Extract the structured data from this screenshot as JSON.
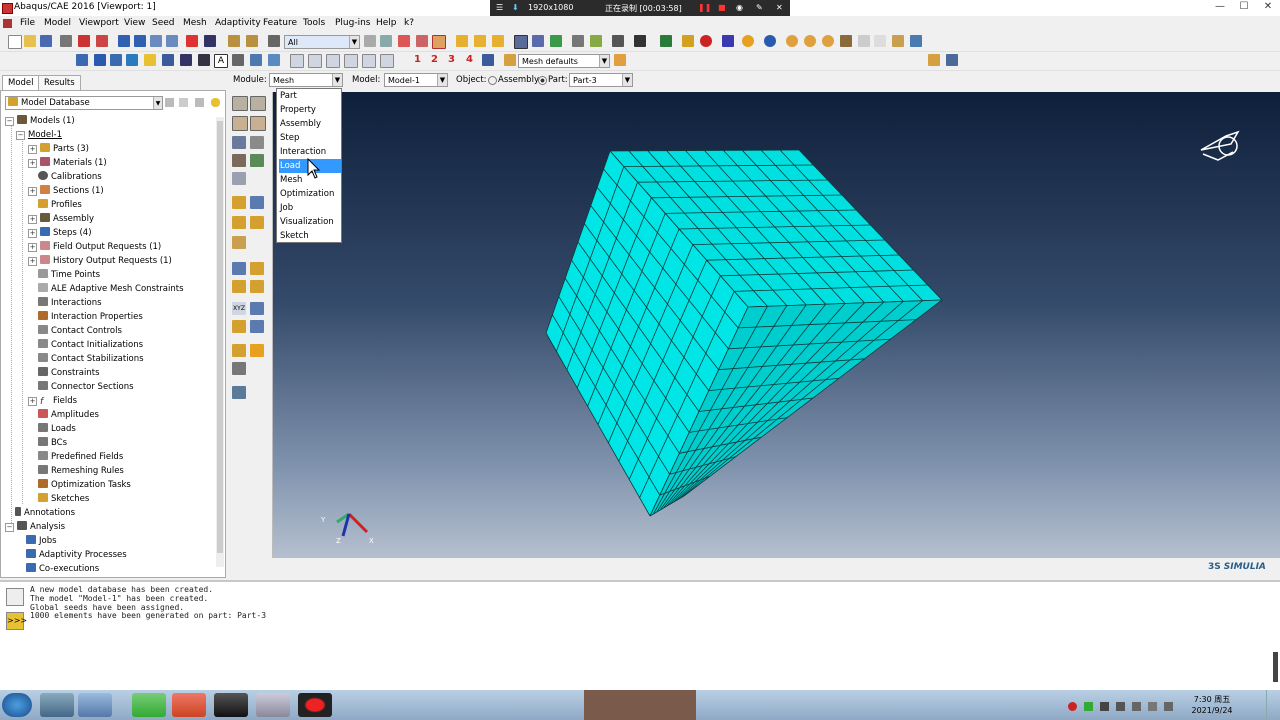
{
  "window": {
    "title": "Abaqus/CAE 2016 [Viewport: 1]",
    "controls": [
      "—",
      "☐",
      "✕"
    ]
  },
  "recorder": {
    "resolution": "1920x1080",
    "status": "正在录制 [00:03:58]"
  },
  "menubar": {
    "items": [
      "File",
      "Model",
      "Viewport",
      "View",
      "Seed",
      "Mesh",
      "Adaptivity",
      "Feature",
      "Tools",
      "Plug-ins",
      "Help",
      "k?"
    ]
  },
  "toolbar": {
    "selection_filter": "All",
    "mesh_defaults": "Mesh defaults",
    "number_buttons": [
      "1",
      "2",
      "3",
      "4"
    ]
  },
  "context": {
    "module_label": "Module:",
    "module_value": "Mesh",
    "model_label": "Model:",
    "model_value": "Model-1",
    "object_label": "Object:",
    "assembly_label": "Assembly",
    "part_label": "Part:",
    "part_value": "Part-3"
  },
  "module_dropdown": {
    "options": [
      "Part",
      "Property",
      "Assembly",
      "Step",
      "Interaction",
      "Load",
      "Mesh",
      "Optimization",
      "Job",
      "Visualization",
      "Sketch"
    ],
    "highlighted": "Load"
  },
  "left_panel": {
    "tabs": [
      "Model",
      "Results"
    ],
    "active_tab": "Model",
    "database_select": "Model Database",
    "tree": [
      "Models (1)",
      "Model-1",
      "Parts (3)",
      "Materials (1)",
      "Calibrations",
      "Sections (1)",
      "Profiles",
      "Assembly",
      "Steps (4)",
      "Field Output Requests (1)",
      "History Output Requests (1)",
      "Time Points",
      "ALE Adaptive Mesh Constraints",
      "Interactions",
      "Interaction Properties",
      "Contact Controls",
      "Contact Initializations",
      "Contact Stabilizations",
      "Constraints",
      "Connector Sections",
      "Fields",
      "Amplitudes",
      "Loads",
      "BCs",
      "Predefined Fields",
      "Remeshing Rules",
      "Optimization Tasks",
      "Sketches",
      "Annotations",
      "Analysis",
      "Jobs",
      "Adaptivity Processes",
      "Co-executions"
    ]
  },
  "viewport": {
    "mesh_color": "#00e5e5",
    "mesh_divisions": 10,
    "triad_labels": {
      "y": "Y",
      "z": "Z",
      "x": "X"
    },
    "brand": "SIMULIA"
  },
  "messages": [
    "A new model database has been created.",
    "The model \"Model-1\" has been created.",
    "Global seeds have been assigned.",
    "1000 elements have been generated on part: Part-3"
  ],
  "taskbar": {
    "time": "7:30 周五",
    "date": "2021/9/24"
  }
}
